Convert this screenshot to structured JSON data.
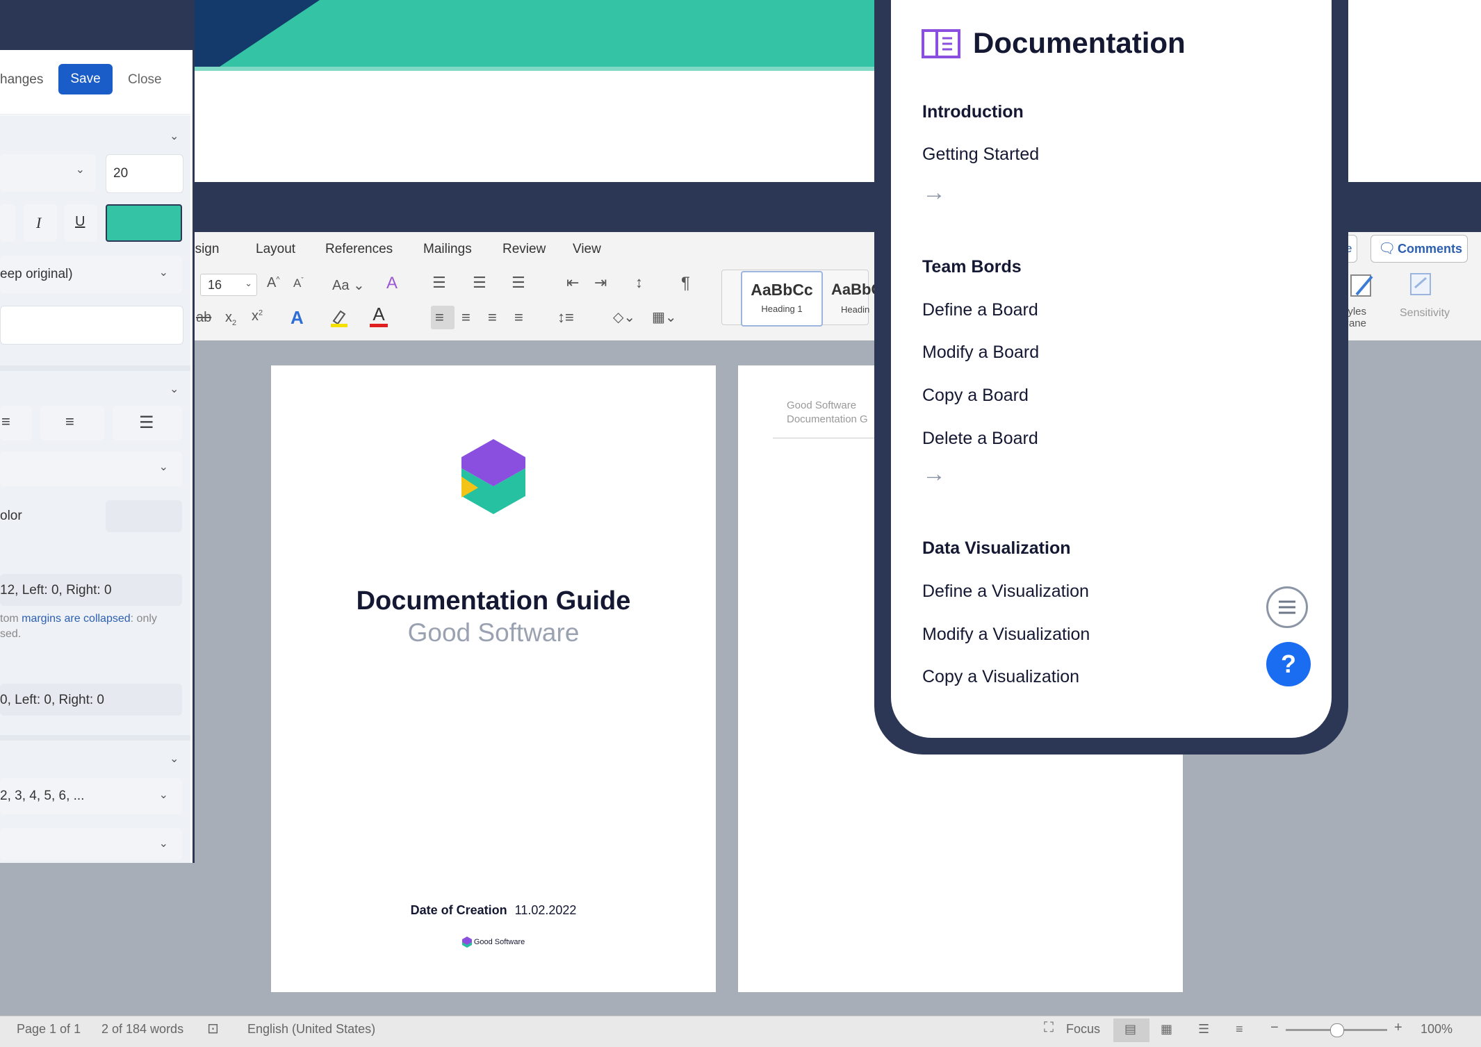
{
  "left_panel": {
    "changes_label": "hanges",
    "save_label": "Save",
    "close_label": "Close",
    "font_size_value": "20",
    "italic_label": "I",
    "underline_label": "U",
    "accent_color": "#34c3a5",
    "image_option": "eep original)",
    "color_label": "olor",
    "margins_1": "12, Left: 0, Right: 0",
    "margin_note_1": "tom",
    "margin_note_link": "margins are collapsed",
    "margin_note_2": ": only",
    "margin_note_3": "sed.",
    "margins_2": "0, Left: 0, Right: 0",
    "numbering": "2, 3, 4, 5, 6, ..."
  },
  "word": {
    "menu_tabs": [
      "esign",
      "Layout",
      "References",
      "Mailings",
      "Review",
      "View"
    ],
    "font_size": "16",
    "styles": [
      {
        "preview": "AaBbCc",
        "name": "Heading 1"
      },
      {
        "preview": "AaBbC",
        "name": "Headin"
      }
    ],
    "comments_label": "Comments",
    "share_partial": "e",
    "styles_pane_label": "tyles\nPane",
    "sensitivity_label": "Sensitivity"
  },
  "cover": {
    "title": "Documentation Guide",
    "subtitle": "Good Software",
    "date_label": "Date of Creation",
    "date_value": "11.02.2022",
    "footer_brand": "Good Software"
  },
  "page2": {
    "header_line1": "Good Software",
    "header_line2": "Documentation G"
  },
  "doc_panel": {
    "title": "Documentation",
    "sections": [
      {
        "heading": "Introduction",
        "items": [
          "Getting Started"
        ]
      },
      {
        "heading": "Team Bords",
        "items": [
          "Define a Board",
          "Modify a Board",
          "Copy a Board",
          "Delete a Board"
        ]
      },
      {
        "heading": "Data Visualization",
        "items": [
          "Define a Visualization",
          "Modify a Visualization",
          "Copy a Visualization"
        ]
      }
    ],
    "arrow": "→",
    "help_label": "?"
  },
  "statusbar": {
    "page": "Page 1 of 1",
    "words": "2 of 184 words",
    "language": "English (United States)",
    "focus": "Focus",
    "zoom": "100%"
  },
  "colors": {
    "navy": "#2c3655",
    "teal": "#34c3a5",
    "save_blue": "#1a5cc8",
    "help_blue": "#1a6cf0",
    "purple": "#8b4fe0"
  }
}
